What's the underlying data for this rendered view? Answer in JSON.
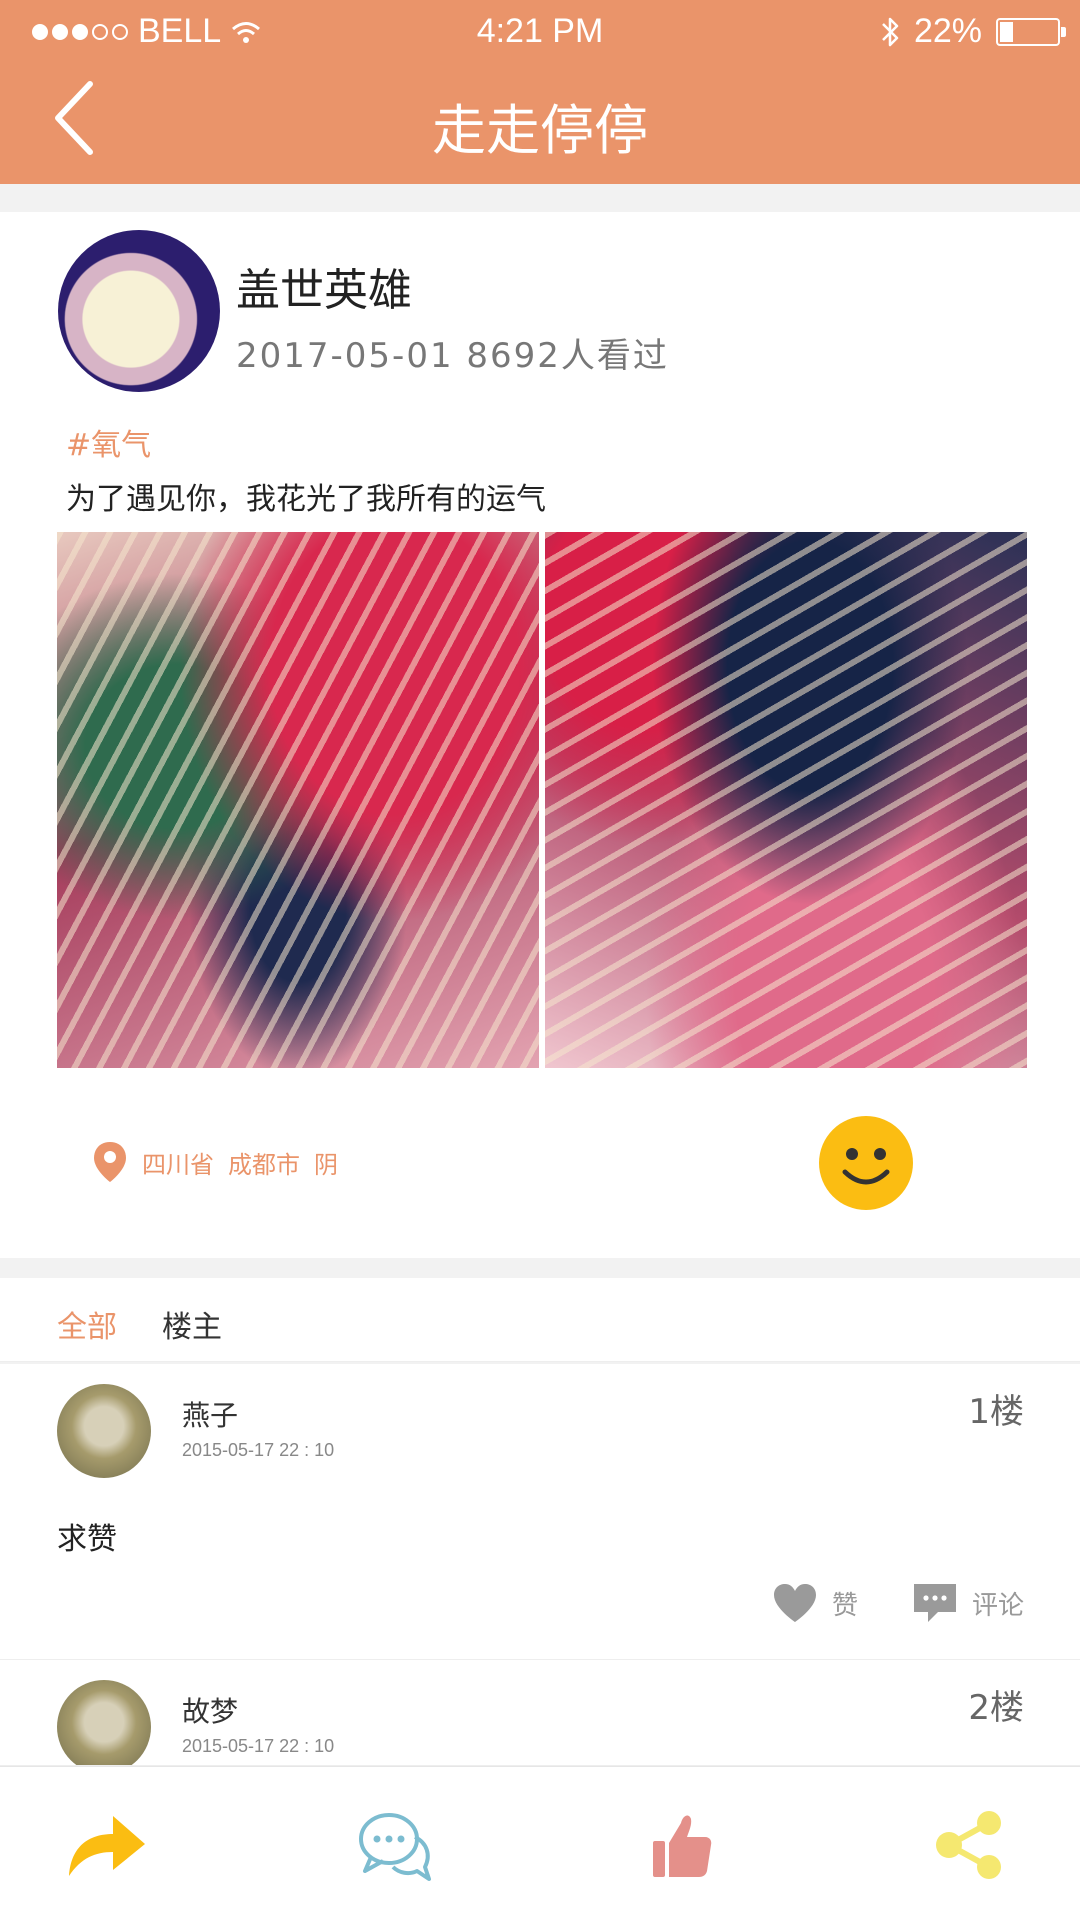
{
  "status_bar": {
    "carrier": "BELL",
    "time": "4:21 PM",
    "battery_text": "22%",
    "battery_level": 0.22,
    "signal_bars_filled": 3,
    "signal_bars_total": 5
  },
  "header": {
    "title": "走走停停"
  },
  "post": {
    "author": "盖世英雄",
    "meta": "2017-05-01 8692人看过",
    "tag": "#氧气",
    "content": "为了遇见你，我花光了我所有的运气",
    "location": {
      "province": "四川省",
      "city": "成都市",
      "weather": "阴"
    }
  },
  "tabs": [
    "全部",
    "楼主"
  ],
  "comments": [
    {
      "name": "燕子",
      "time": "2015-05-17    22 : 10",
      "floor": "1楼",
      "text": "求赞",
      "like_label": "赞",
      "comment_label": "评论"
    },
    {
      "name": "故梦",
      "time": "2015-05-17    22 : 10",
      "floor": "2楼"
    }
  ],
  "colors": {
    "accent": "#ea946a",
    "smiley": "#fbbd12",
    "forward": "#fbbd12",
    "chat": "#7cbcd0",
    "thumb": "#e4908a",
    "share": "#f5e870"
  },
  "icons": {
    "back": "chevron-left-icon",
    "location": "location-pin-icon",
    "smiley": "smiley-icon",
    "like": "heart-icon",
    "comment": "comment-bubble-icon",
    "forward": "forward-arrow-icon",
    "chat": "chat-bubbles-icon",
    "thumb": "thumbs-up-icon",
    "share": "share-icon"
  }
}
